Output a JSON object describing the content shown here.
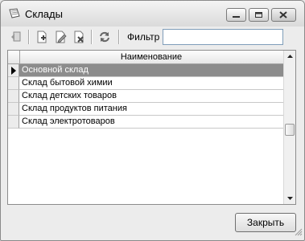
{
  "window": {
    "title": "Склады"
  },
  "toolbar": {
    "buttons": [
      "back-icon",
      "add-icon",
      "edit-icon",
      "delete-icon",
      "refresh-icon"
    ],
    "filter_label": "Фильтр",
    "filter_value": ""
  },
  "grid": {
    "column_header": "Наименование",
    "rows": [
      "Основной склад",
      "Склад бытовой химии",
      "Склад детских товаров",
      "Склад продуктов питания",
      "Склад электротоваров"
    ],
    "selected_index": 0
  },
  "footer": {
    "close_label": "Закрыть"
  }
}
